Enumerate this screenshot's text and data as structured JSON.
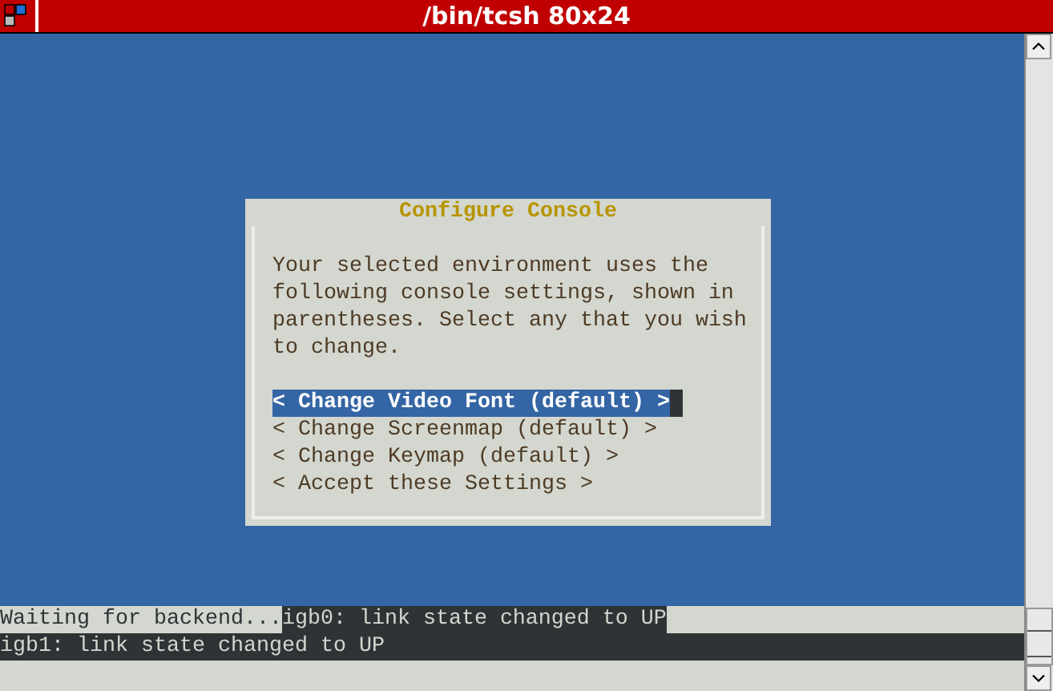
{
  "window": {
    "title": "/bin/tcsh 80x24"
  },
  "dialog": {
    "title": "Configure Console",
    "message": "Your selected environment uses the following console settings, shown in parentheses. Select any that you wish to change.",
    "menu": [
      {
        "label": "< Change Video Font (default) >",
        "selected": true
      },
      {
        "label": "< Change Screenmap (default) >",
        "selected": false
      },
      {
        "label": "< Change Keymap (default) >",
        "selected": false
      },
      {
        "label": "< Accept these Settings >",
        "selected": false
      }
    ]
  },
  "console_lines": [
    {
      "inverse": true,
      "segments": [
        {
          "text": "Waiting for backend...",
          "inverse": true
        },
        {
          "text": "igb0: link state changed to UP",
          "inverse": false
        }
      ]
    },
    {
      "inverse": false,
      "segments": [
        {
          "text": "igb1: link state changed to UP",
          "inverse": false
        }
      ]
    }
  ]
}
